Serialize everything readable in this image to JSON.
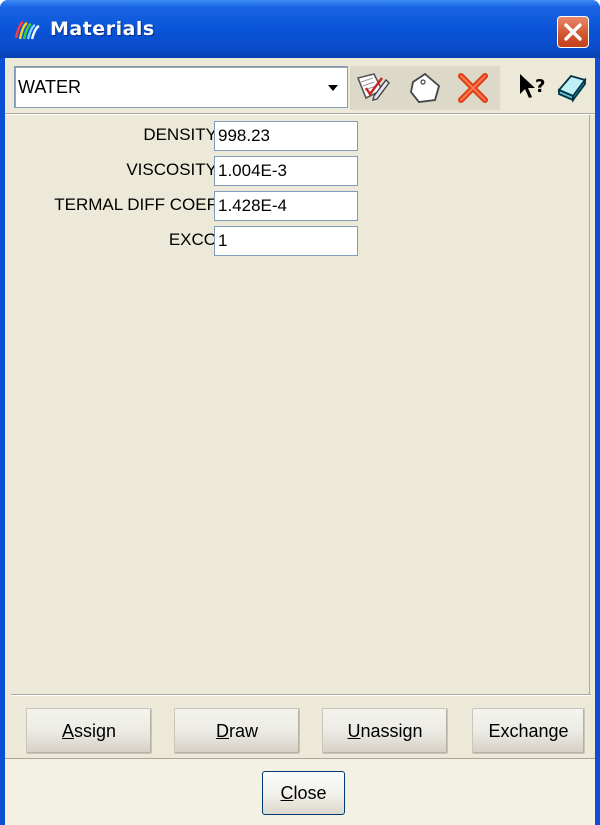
{
  "window": {
    "title": "Materials",
    "title_icon": "materials-app-icon",
    "close_icon": "close-icon"
  },
  "toolbar": {
    "material_selected": "WATER",
    "icons": [
      "edit-material-icon",
      "rename-tag-icon",
      "delete-icon",
      "help-pointer-icon",
      "eraser-icon"
    ]
  },
  "fields": [
    {
      "label": "DENSITY",
      "value": "998.23"
    },
    {
      "label": "VISCOSITY",
      "value": "1.004E-3"
    },
    {
      "label": "TERMAL DIFF COEF",
      "value": "1.428E-4"
    },
    {
      "label": "EXCO",
      "value": "1"
    }
  ],
  "buttons": {
    "assign_first": "A",
    "assign_rest": "ssign",
    "draw_first": "D",
    "draw_rest": "raw",
    "unassign_first": "U",
    "unassign_rest": "nassign",
    "exchange": "Exchange",
    "close_first": "C",
    "close_rest": "lose"
  }
}
